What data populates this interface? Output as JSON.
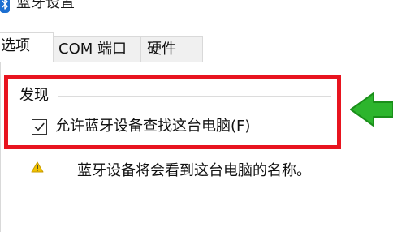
{
  "window": {
    "title": "蓝牙设置",
    "icon": "bluetooth-icon"
  },
  "tabs": [
    {
      "label": "选项",
      "active": true
    },
    {
      "label": "COM 端口",
      "active": false
    },
    {
      "label": "硬件",
      "active": false
    }
  ],
  "discovery": {
    "group_label": "发现",
    "checkbox_label": "允许蓝牙设备查找这台电脑(F)",
    "checked": true
  },
  "warning": {
    "icon": "warning-icon",
    "text": "蓝牙设备将会看到这台电脑的名称。"
  },
  "annotations": {
    "highlight_color": "#e8141f",
    "arrow_color": "#22a822"
  }
}
